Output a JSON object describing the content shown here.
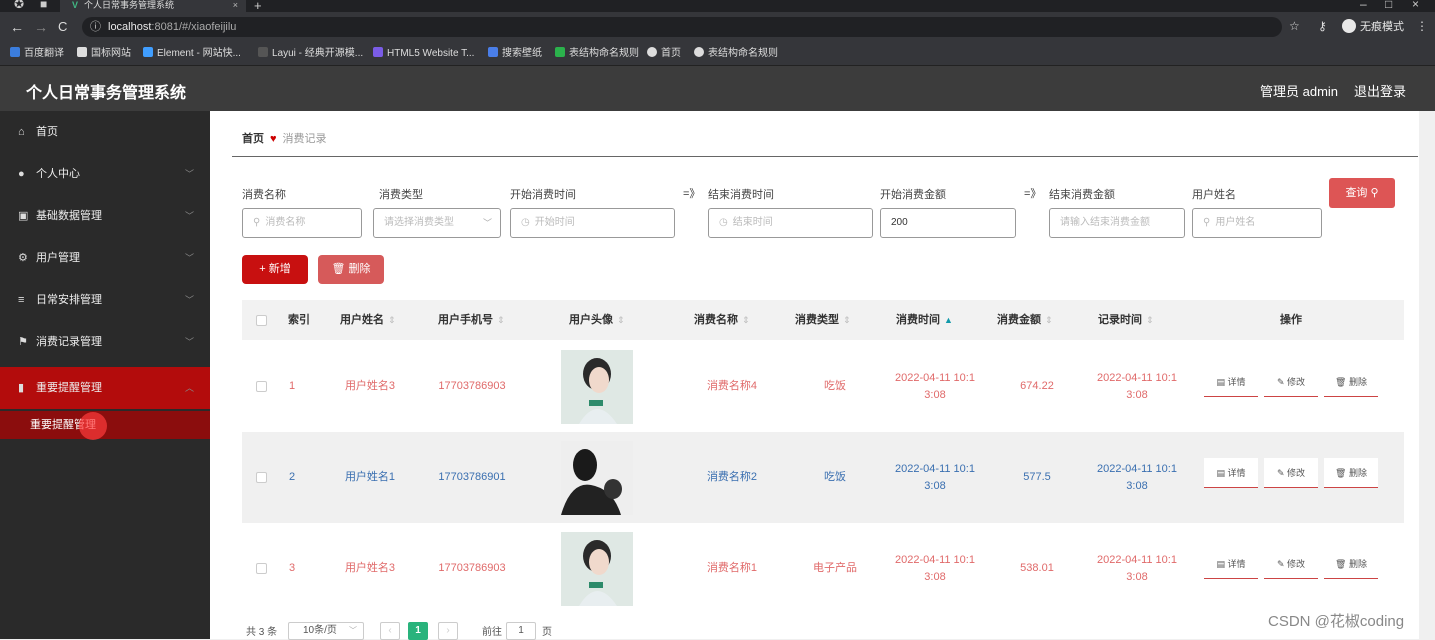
{
  "browser": {
    "tab_title": "个人日常事务管理系统",
    "url_host": "localhost",
    "url_rest": ":8081/#/xiaofeijilu",
    "incognito_label": "无痕模式",
    "bookmarks": [
      "百度翻译",
      "国标网站",
      "Element - 网站快...",
      "Layui - 经典开源模...",
      "HTML5 Website T...",
      "搜索壁纸",
      "表结构命名规则",
      "首页",
      "表结构命名规则"
    ]
  },
  "header": {
    "title": "个人日常事务管理系统",
    "user": "管理员 admin",
    "logout": "退出登录"
  },
  "sidebar": {
    "items": [
      {
        "label": "首页",
        "icon": "home-icon"
      },
      {
        "label": "个人中心",
        "icon": "user-icon"
      },
      {
        "label": "基础数据管理",
        "icon": "database-icon"
      },
      {
        "label": "用户管理",
        "icon": "gear-icon"
      },
      {
        "label": "日常安排管理",
        "icon": "list-icon"
      },
      {
        "label": "消费记录管理",
        "icon": "flag-icon"
      },
      {
        "label": "重要提醒管理",
        "icon": "bar-chart-icon"
      }
    ],
    "sub_item": "重要提醒管理"
  },
  "breadcrumb": {
    "home": "首页",
    "current": "消费记录"
  },
  "filters": {
    "name_label": "消费名称",
    "name_placeholder": "消费名称",
    "type_label": "消费类型",
    "type_placeholder": "请选择消费类型",
    "start_time_label": "开始消费时间",
    "start_time_placeholder": "开始时间",
    "arrow": "=》",
    "end_time_label": "结束消费时间",
    "end_time_placeholder": "结束时间",
    "min_amount_label": "开始消费金额",
    "min_amount_value": "200",
    "max_amount_label": "结束消费金额",
    "max_amount_placeholder": "请输入结束消费金额",
    "user_label": "用户姓名",
    "user_placeholder": "用户姓名",
    "query_button": "查询"
  },
  "actions": {
    "add": "新增",
    "delete": "删除"
  },
  "table": {
    "headers": [
      "索引",
      "用户姓名",
      "用户手机号",
      "用户头像",
      "消费名称",
      "消费类型",
      "消费时间",
      "消费金额",
      "记录时间",
      "操作"
    ],
    "rows": [
      {
        "index": "1",
        "user": "用户姓名3",
        "phone": "17703786903",
        "name": "消费名称4",
        "type": "吃饭",
        "time1": "2022-04-11 10:1",
        "time2": "3:08",
        "amount": "674.22",
        "rec1": "2022-04-11 10:1",
        "rec2": "3:08",
        "style": "red"
      },
      {
        "index": "2",
        "user": "用户姓名1",
        "phone": "17703786901",
        "name": "消费名称2",
        "type": "吃饭",
        "time1": "2022-04-11 10:1",
        "time2": "3:08",
        "amount": "577.5",
        "rec1": "2022-04-11 10:1",
        "rec2": "3:08",
        "style": "blue"
      },
      {
        "index": "3",
        "user": "用户姓名3",
        "phone": "17703786903",
        "name": "消费名称1",
        "type": "电子产品",
        "time1": "2022-04-11 10:1",
        "time2": "3:08",
        "amount": "538.01",
        "rec1": "2022-04-11 10:1",
        "rec2": "3:08",
        "style": "red"
      }
    ],
    "ops": {
      "detail": "详情",
      "edit": "修改",
      "delete": "删除"
    }
  },
  "pagination": {
    "total": "共 3 条",
    "page_size": "10条/页",
    "current": "1",
    "goto": "前往",
    "goto_value": "1",
    "page_unit": "页"
  },
  "watermark": "CSDN @花椒coding"
}
